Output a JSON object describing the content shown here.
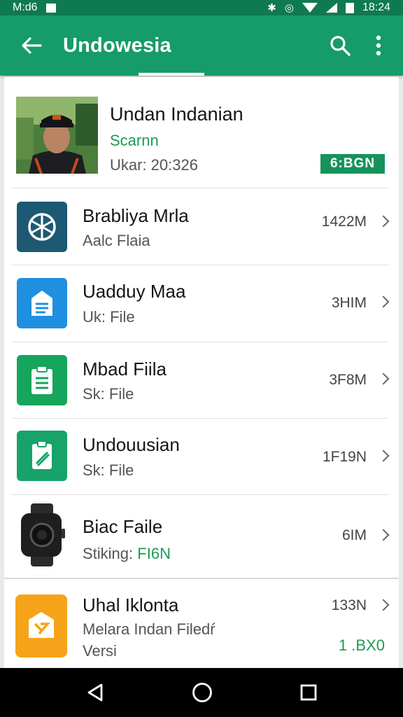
{
  "status_bar": {
    "left_text": "M:d6",
    "time": "18:24"
  },
  "app_bar": {
    "title": "Undowesia"
  },
  "profile": {
    "name": "Undan Indanian",
    "status": "Scarnn",
    "meta": "Ukar: 20:326",
    "badge": "6:BGN",
    "badge_color": "#16935c"
  },
  "files": [
    {
      "title": "Brabliya Mrla",
      "subtitle": "Aalc Flaia",
      "size": "1422M",
      "icon": "aperture-icon",
      "color": "#1d5972"
    },
    {
      "title": "Uadduy Maa",
      "subtitle": "Uk: File",
      "size": "3HIM",
      "icon": "document-icon",
      "color": "#1f8fe0"
    },
    {
      "title": "Mbad Fiila",
      "subtitle": "Sk: File",
      "size": "3F8M",
      "icon": "clipboard-icon",
      "color": "#16a55c"
    },
    {
      "title": "Undouusian",
      "subtitle": "Sk: File",
      "size": "1F19N",
      "icon": "pencil-file-icon",
      "color": "#17a36a"
    },
    {
      "title": "Biac Faile",
      "subtitle_label": "Stiking:",
      "subtitle_value": "FI6N",
      "size": "6IM",
      "icon": "smartwatch-icon"
    },
    {
      "title": "Uhal Iklonta",
      "subtitle_line1": "Melara Indan Filedŕ",
      "subtitle_line2": "Versi",
      "size": "133N",
      "extra": "1 .BX0",
      "icon": "tag-file-icon",
      "color": "#f5a41a"
    }
  ]
}
